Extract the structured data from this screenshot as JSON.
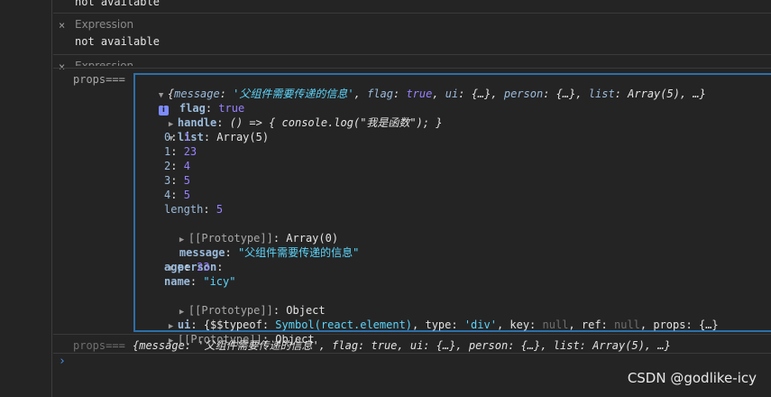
{
  "expressions": [
    {
      "value": "not available"
    },
    {
      "header": "Expression",
      "close": "×",
      "value": "not available"
    },
    {
      "header": "Expression",
      "close": "×"
    }
  ],
  "log": {
    "label": "props===",
    "summary_open": "{",
    "summary": {
      "message_key": "message",
      "message_val": "'父组件需要传递的信息'",
      "flag_key": "flag",
      "flag_val": "true",
      "ui_key": "ui",
      "ui_val": "{…}",
      "person_key": "person",
      "person_val": "{…}",
      "list_key": "list",
      "list_val": "Array(5)",
      "tail": ", …}"
    },
    "info": "i",
    "flag_key": "flag",
    "flag_val": "true",
    "handle_key": "handle",
    "handle_val": "() => { console.log(\"我是函数\"); }",
    "list_key": "list",
    "list_val": "Array(5)",
    "list_items": [
      {
        "idx": "0",
        "val": "1"
      },
      {
        "idx": "1",
        "val": "23"
      },
      {
        "idx": "2",
        "val": "4"
      },
      {
        "idx": "3",
        "val": "5"
      },
      {
        "idx": "4",
        "val": "5"
      }
    ],
    "length_key": "length",
    "length_val": "5",
    "list_proto": "[[Prototype]]",
    "list_proto_val": "Array(0)",
    "message_key": "message",
    "message_val": "\"父组件需要传递的信息\"",
    "person_key": "person",
    "age_key": "age",
    "age_val": "23",
    "name_key": "name",
    "name_val": "\"icy\"",
    "person_proto": "[[Prototype]]",
    "person_proto_val": "Object",
    "ui_key": "ui",
    "ui_val_prefix": "{$$typeof: ",
    "ui_symbol": "Symbol(react.element)",
    "ui_type_key": ", type: ",
    "ui_type_val": "'div'",
    "ui_key_key": ", key: ",
    "ui_key_val": "null",
    "ui_ref_key": ", ref: ",
    "ui_ref_val": "null",
    "ui_props_key": ", props: ",
    "ui_props_val": "{…}, …}",
    "obj_proto": "[[Prototype]]",
    "obj_proto_val": "Object"
  },
  "repeat_log": {
    "label": "props===",
    "summary": "{message: '父组件需要传递的信息', flag: true, ui: {…}, person: {…}, list: Array(5), …}"
  },
  "prompt": "›",
  "watermark": "CSDN @godlike-icy"
}
